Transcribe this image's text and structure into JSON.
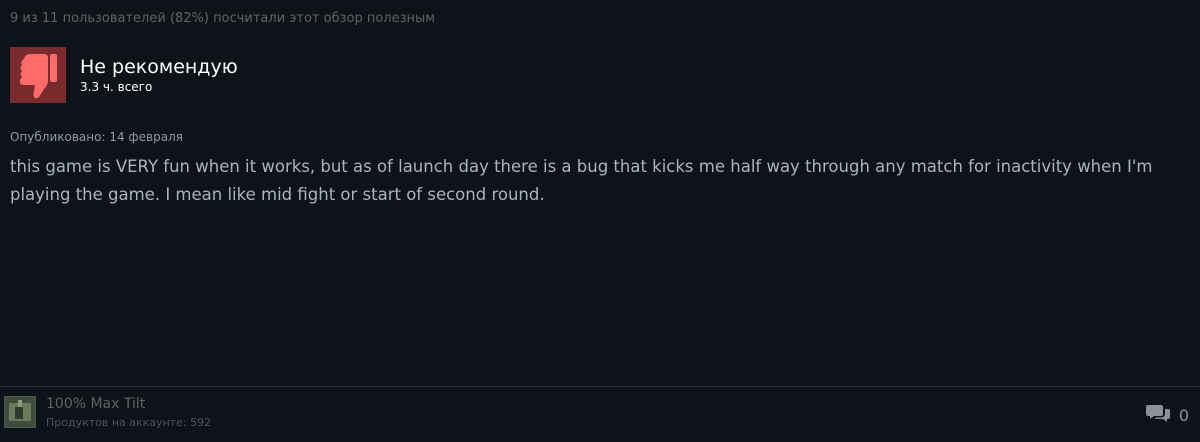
{
  "review": {
    "helpful_text": "9 из 11 пользователей (82%) посчитали этот обзор полезным",
    "verdict": {
      "title": "Не рекомендую",
      "hours": "3.3 ч. всего",
      "icon": "thumbs-down-icon",
      "icon_bg_color": "#7a2b2d",
      "icon_color": "#ff6b6b"
    },
    "posted": "Опубликовано: 14 февраля",
    "body": "this game is VERY fun when it works, but as of launch day there is a bug that kicks me half way through any match for inactivity when I'm playing the game. I mean like mid fight or start of second round."
  },
  "author": {
    "name": "100% Max Tilt",
    "games": "Продуктов на аккаунте: 592"
  },
  "comments": {
    "icon": "comments-icon",
    "count": "0"
  }
}
